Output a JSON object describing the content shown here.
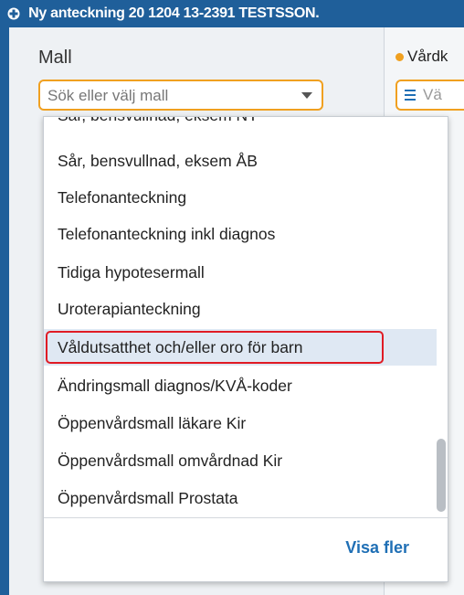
{
  "window": {
    "title": "Ny anteckning 20 1204 13-2391 TESTSSON."
  },
  "template_field": {
    "label": "Mall",
    "placeholder": "Sök eller välj mall"
  },
  "right_panel": {
    "label": "Vårdk",
    "field_placeholder": "Vä"
  },
  "dropdown": {
    "partial_item": "Sår, bensvullnad, eksem NY",
    "items": [
      "Sår, bensvullnad, eksem ÅB",
      "Telefonanteckning",
      "Telefonanteckning inkl diagnos",
      "Tidiga hypotesermall",
      "Uroterapianteckning",
      "Våldutsatthet och/eller oro för barn",
      "Ändringsmall diagnos/KVÅ-koder",
      "Öppenvårdsmall läkare Kir",
      "Öppenvårdsmall omvårdnad Kir",
      "Öppenvårdsmall Prostata"
    ],
    "highlighted_item": "Våldutsatthet och/eller oro för barn",
    "more_label": "Visa fler"
  },
  "colors": {
    "header": "#1f5f9a",
    "accent": "#f0a020",
    "highlight": "#dfe8f3",
    "outline": "#e01b24",
    "link": "#1f6fb5"
  },
  "icons": {
    "app": "medical-cross-icon",
    "list": "list-icon",
    "dropdown": "chevron-down-icon"
  }
}
